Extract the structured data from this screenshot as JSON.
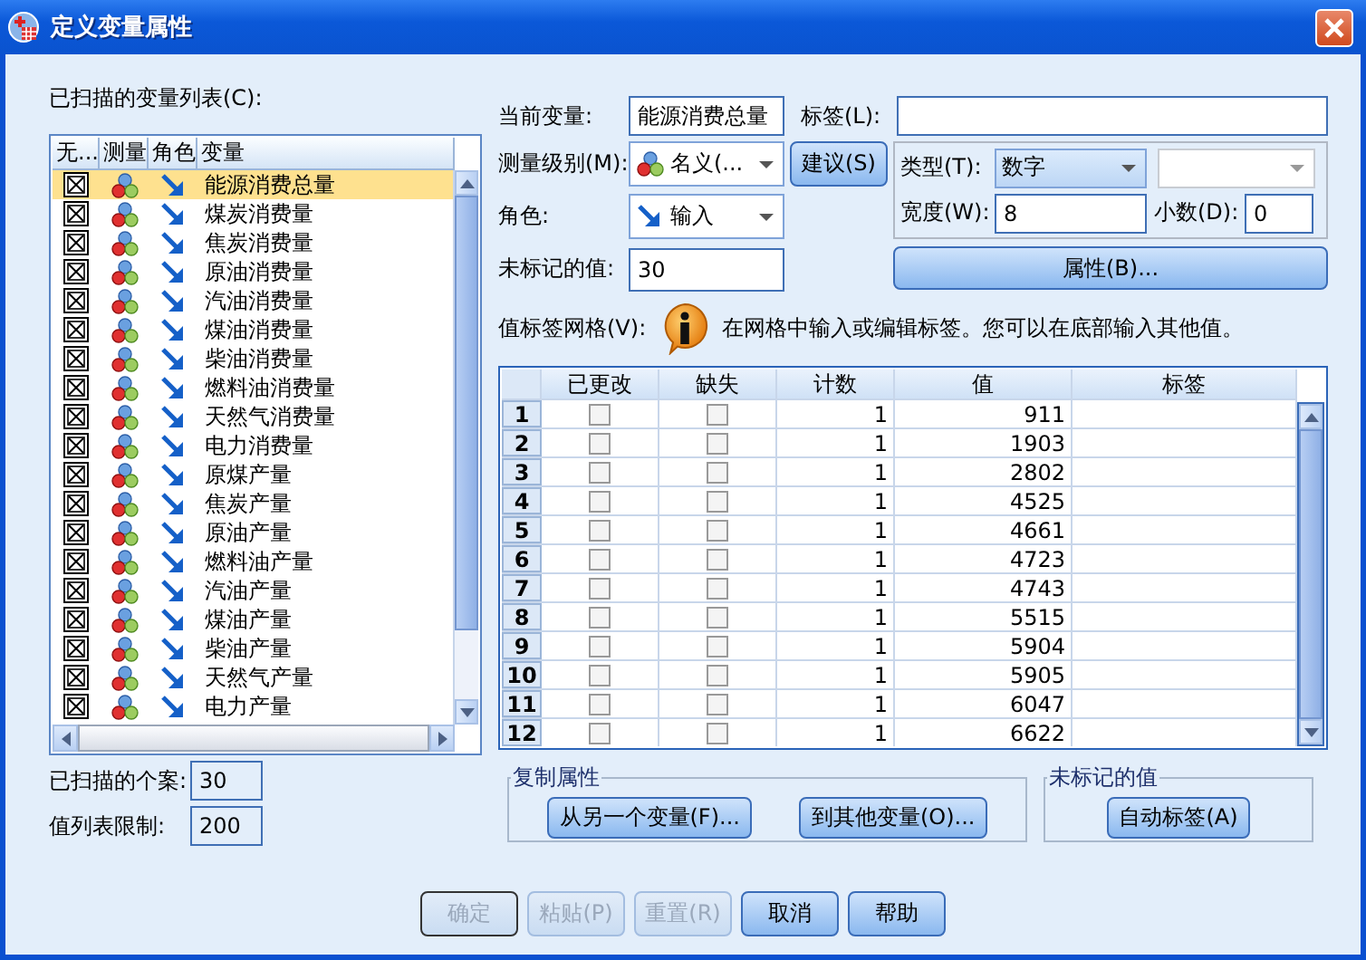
{
  "window": {
    "title": "定义变量属性"
  },
  "variable_list": {
    "label": "已扫描的变量列表(C):",
    "columns": [
      "无...",
      "测量",
      "角色",
      "变量"
    ],
    "rows": [
      {
        "name": "能源消费总量",
        "checked": true,
        "selected": true
      },
      {
        "name": "煤炭消费量",
        "checked": true,
        "selected": false
      },
      {
        "name": "焦炭消费量",
        "checked": true,
        "selected": false
      },
      {
        "name": "原油消费量",
        "checked": true,
        "selected": false
      },
      {
        "name": "汽油消费量",
        "checked": true,
        "selected": false
      },
      {
        "name": "煤油消费量",
        "checked": true,
        "selected": false
      },
      {
        "name": "柴油消费量",
        "checked": true,
        "selected": false
      },
      {
        "name": "燃料油消费量",
        "checked": true,
        "selected": false
      },
      {
        "name": "天然气消费量",
        "checked": true,
        "selected": false
      },
      {
        "name": "电力消费量",
        "checked": true,
        "selected": false
      },
      {
        "name": "原煤产量",
        "checked": true,
        "selected": false
      },
      {
        "name": "焦炭产量",
        "checked": true,
        "selected": false
      },
      {
        "name": "原油产量",
        "checked": true,
        "selected": false
      },
      {
        "name": "燃料油产量",
        "checked": true,
        "selected": false
      },
      {
        "name": "汽油产量",
        "checked": true,
        "selected": false
      },
      {
        "name": "煤油产量",
        "checked": true,
        "selected": false
      },
      {
        "name": "柴油产量",
        "checked": true,
        "selected": false
      },
      {
        "name": "天然气产量",
        "checked": true,
        "selected": false
      },
      {
        "name": "电力产量",
        "checked": true,
        "selected": false
      }
    ]
  },
  "cases_scanned": {
    "label": "已扫描的个案:",
    "value": "30"
  },
  "value_list_limit": {
    "label": "值列表限制:",
    "value": "200"
  },
  "current_variable": {
    "label": "当前变量:",
    "value": "能源消费总量"
  },
  "label_field": {
    "label": "标签(L):"
  },
  "measure_level": {
    "label": "测量级别(M):",
    "value": "名义(..."
  },
  "suggest_button": "建议(S)",
  "role": {
    "label": "角色:",
    "value": "输入"
  },
  "unlabeled_values": {
    "label": "未标记的值:",
    "value": "30"
  },
  "type": {
    "label": "类型(T):",
    "value": "数字"
  },
  "width": {
    "label": "宽度(W):",
    "value": "8"
  },
  "decimals": {
    "label": "小数(D):",
    "value": "0"
  },
  "attributes_button": "属性(B)...",
  "grid_label": "值标签网格(V):",
  "info": "在网格中输入或编辑标签。您可以在底部输入其他值。",
  "grid": {
    "columns": [
      "已更改",
      "缺失",
      "计数",
      "值",
      "标签"
    ],
    "rows": [
      {
        "number": "1",
        "changed": false,
        "missing": false,
        "count": "1",
        "value": "911"
      },
      {
        "number": "2",
        "changed": false,
        "missing": false,
        "count": "1",
        "value": "1903"
      },
      {
        "number": "3",
        "changed": false,
        "missing": false,
        "count": "1",
        "value": "2802"
      },
      {
        "number": "4",
        "changed": false,
        "missing": false,
        "count": "1",
        "value": "4525"
      },
      {
        "number": "5",
        "changed": false,
        "missing": false,
        "count": "1",
        "value": "4661"
      },
      {
        "number": "6",
        "changed": false,
        "missing": false,
        "count": "1",
        "value": "4723"
      },
      {
        "number": "7",
        "changed": false,
        "missing": false,
        "count": "1",
        "value": "4743"
      },
      {
        "number": "8",
        "changed": false,
        "missing": false,
        "count": "1",
        "value": "5515"
      },
      {
        "number": "9",
        "changed": false,
        "missing": false,
        "count": "1",
        "value": "5904"
      },
      {
        "number": "10",
        "changed": false,
        "missing": false,
        "count": "1",
        "value": "5905"
      },
      {
        "number": "11",
        "changed": false,
        "missing": false,
        "count": "1",
        "value": "6047"
      },
      {
        "number": "12",
        "changed": false,
        "missing": false,
        "count": "1",
        "value": "6622"
      }
    ]
  },
  "copy_group": {
    "title": "复制属性",
    "buttons": [
      "从另一个变量(F)...",
      "到其他变量(O)..."
    ]
  },
  "unlabeled_group": {
    "title": "未标记的值",
    "buttons": [
      "自动标签(A)"
    ]
  },
  "buttons": [
    {
      "label": "确定",
      "disabled": true
    },
    {
      "label": "粘贴(P)",
      "disabled": true
    },
    {
      "label": "重置(R)",
      "disabled": true
    },
    {
      "label": "取消",
      "disabled": false
    },
    {
      "label": "帮助",
      "disabled": false
    }
  ]
}
